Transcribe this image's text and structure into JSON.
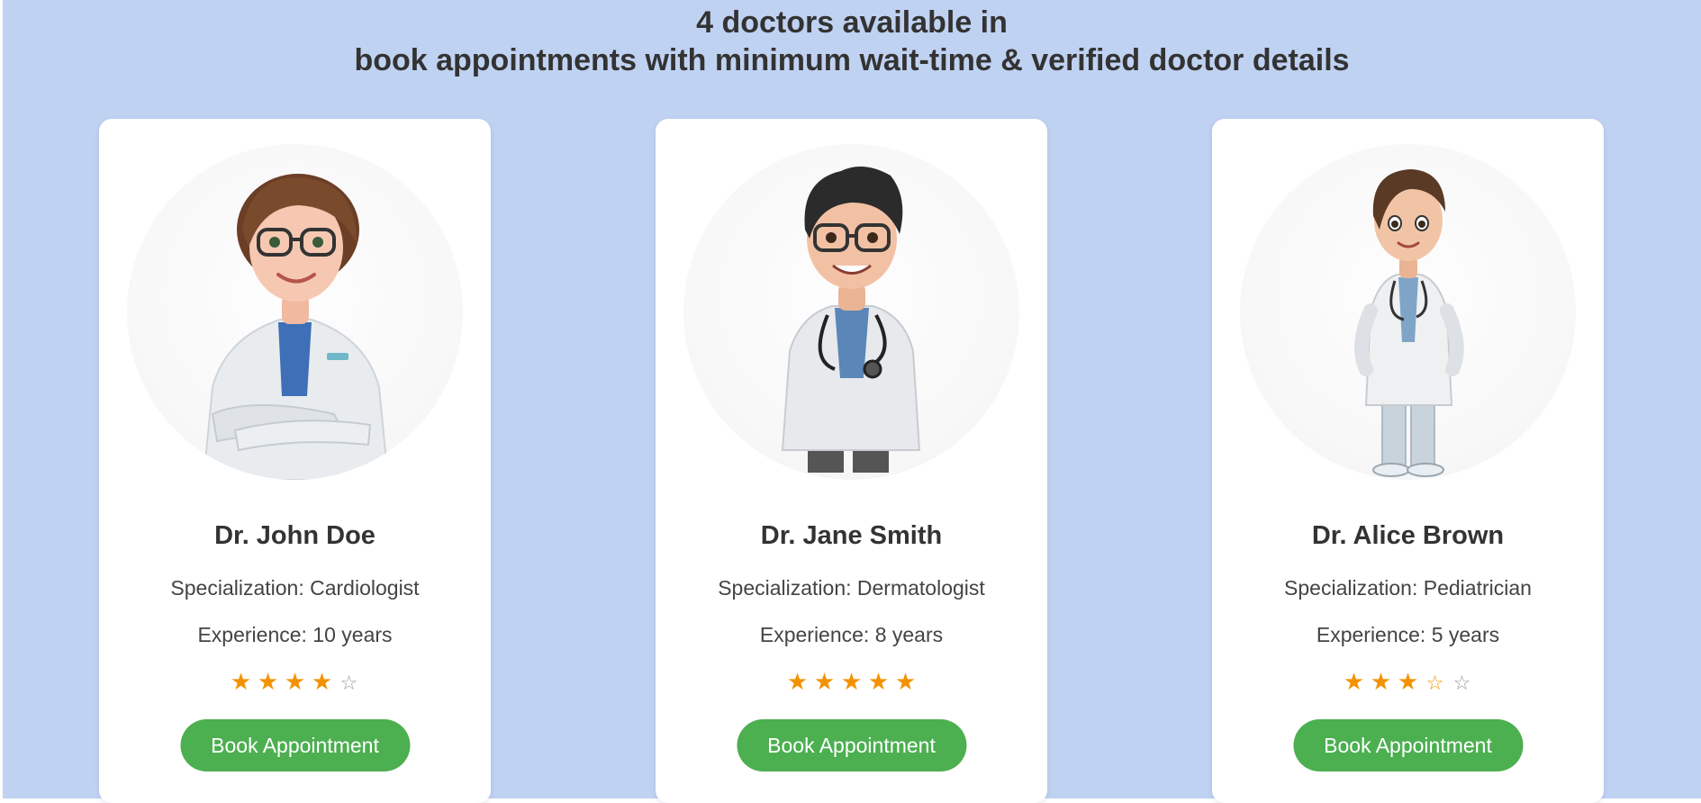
{
  "header": {
    "line1": "4 doctors available in",
    "line2": "book appointments with minimum wait-time & verified doctor details"
  },
  "colors": {
    "background": "#c0d2f2",
    "card": "#ffffff",
    "button": "#4caf50",
    "star": "#f39200",
    "text": "#333333"
  },
  "doctors": [
    {
      "name": "Dr. John Doe",
      "specialization": "Specialization: Cardiologist",
      "experience": "Experience: 10 years",
      "rating": 4,
      "rating_max": 5,
      "avatar_icon": "female-doctor-cartoon-icon",
      "button_label": "Book Appointment"
    },
    {
      "name": "Dr. Jane Smith",
      "specialization": "Specialization: Dermatologist",
      "experience": "Experience: 8 years",
      "rating": 5,
      "rating_max": 5,
      "avatar_icon": "male-doctor-cartoon-icon",
      "button_label": "Book Appointment"
    },
    {
      "name": "Dr. Alice Brown",
      "specialization": "Specialization: Pediatrician",
      "experience": "Experience: 5 years",
      "rating": 3.5,
      "rating_max": 5,
      "avatar_icon": "young-doctor-cartoon-icon",
      "button_label": "Book Appointment"
    }
  ]
}
